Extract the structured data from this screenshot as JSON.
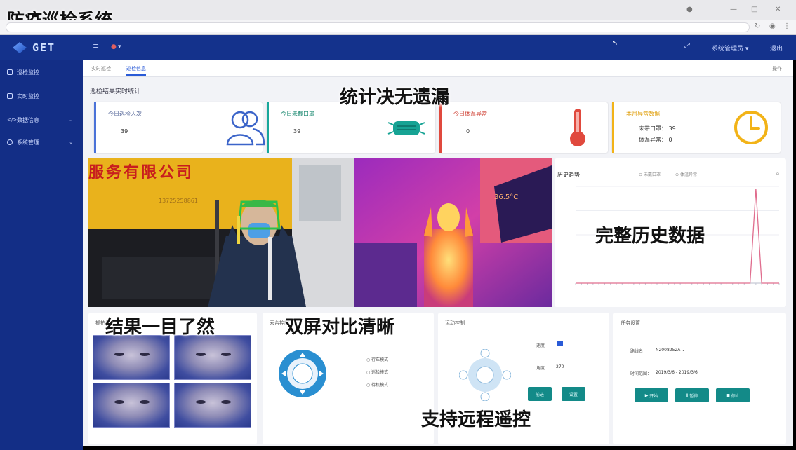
{
  "window": {
    "title": "防疫巡检系统"
  },
  "app": {
    "logo": "GET",
    "top_menu": "●",
    "top_right_user": "系统管理员 ▾",
    "top_right_exit": "退出"
  },
  "sidebar": {
    "items": [
      {
        "label": "巡检监控",
        "icon": "monitor-icon"
      },
      {
        "label": "实时监控",
        "icon": "camera-icon"
      },
      {
        "label": "数据信息",
        "icon": "data-icon"
      },
      {
        "label": "系统管理",
        "icon": "gear-icon"
      }
    ]
  },
  "tabs": [
    {
      "label": "实时巡检"
    },
    {
      "label": "巡检信息"
    }
  ],
  "tabs_right": "操作",
  "stats": {
    "title": "巡检结果实时统计",
    "cards": [
      {
        "label": "今日巡检人次",
        "value": "39",
        "color": "#4a72d8"
      },
      {
        "label": "今日未戴口罩",
        "value": "39",
        "color": "#18a79b"
      },
      {
        "label": "今日体温异常",
        "value": "0",
        "color": "#e0493d"
      },
      {
        "label": "本月异常数据",
        "value": "",
        "color": "#f2b318",
        "lines": [
          "未带口罩：  39",
          "体温异常：  0"
        ]
      }
    ]
  },
  "history": {
    "title": "历史趋势",
    "legend": [
      "未戴口罩",
      "体温异常"
    ]
  },
  "chart_data": {
    "type": "line",
    "title": "历史趋势",
    "xlabel": "",
    "ylabel": "",
    "x_count": 36,
    "series": [
      {
        "name": "未戴口罩",
        "peak_index": 31,
        "peak_value": 39,
        "values": [
          0,
          0,
          0,
          0,
          0,
          0,
          0,
          0,
          0,
          0,
          0,
          0,
          0,
          0,
          0,
          0,
          0,
          0,
          0,
          0,
          0,
          0,
          0,
          0,
          0,
          0,
          0,
          0,
          0,
          0,
          0,
          39,
          0,
          0,
          0,
          0
        ]
      }
    ],
    "ylim": [
      0,
      40
    ],
    "grid": true
  },
  "panels": {
    "faces_title": "抓拍结果",
    "ptz_title": "云台控制",
    "ptz_modes": [
      "行车模式",
      "巡检模式",
      "待机模式"
    ],
    "remote_title": "运动控制",
    "remote_fields": [
      {
        "label": "速度",
        "value": ""
      },
      {
        "label": "角度",
        "value": "270"
      }
    ],
    "remote_buttons": [
      "前进",
      "设置"
    ],
    "task_title": "任务设置",
    "task_fields": [
      {
        "label": "路线名：",
        "value": "N2008252A"
      },
      {
        "label": "时间范围：",
        "value": "2019/3/6 - 2019/3/6"
      }
    ],
    "task_buttons": [
      "开始",
      "暂停",
      "停止"
    ]
  },
  "captions": {
    "c1": "统计决无遗漏",
    "c2": "完整历史数据",
    "c3": "结果一目了然",
    "c4": "双屏对比清晰",
    "c5": "支持远程遥控"
  },
  "scene": {
    "sign_text": "服务有限公司",
    "sign_phone": "13725258861",
    "thermal_readout": "36.5°C"
  }
}
